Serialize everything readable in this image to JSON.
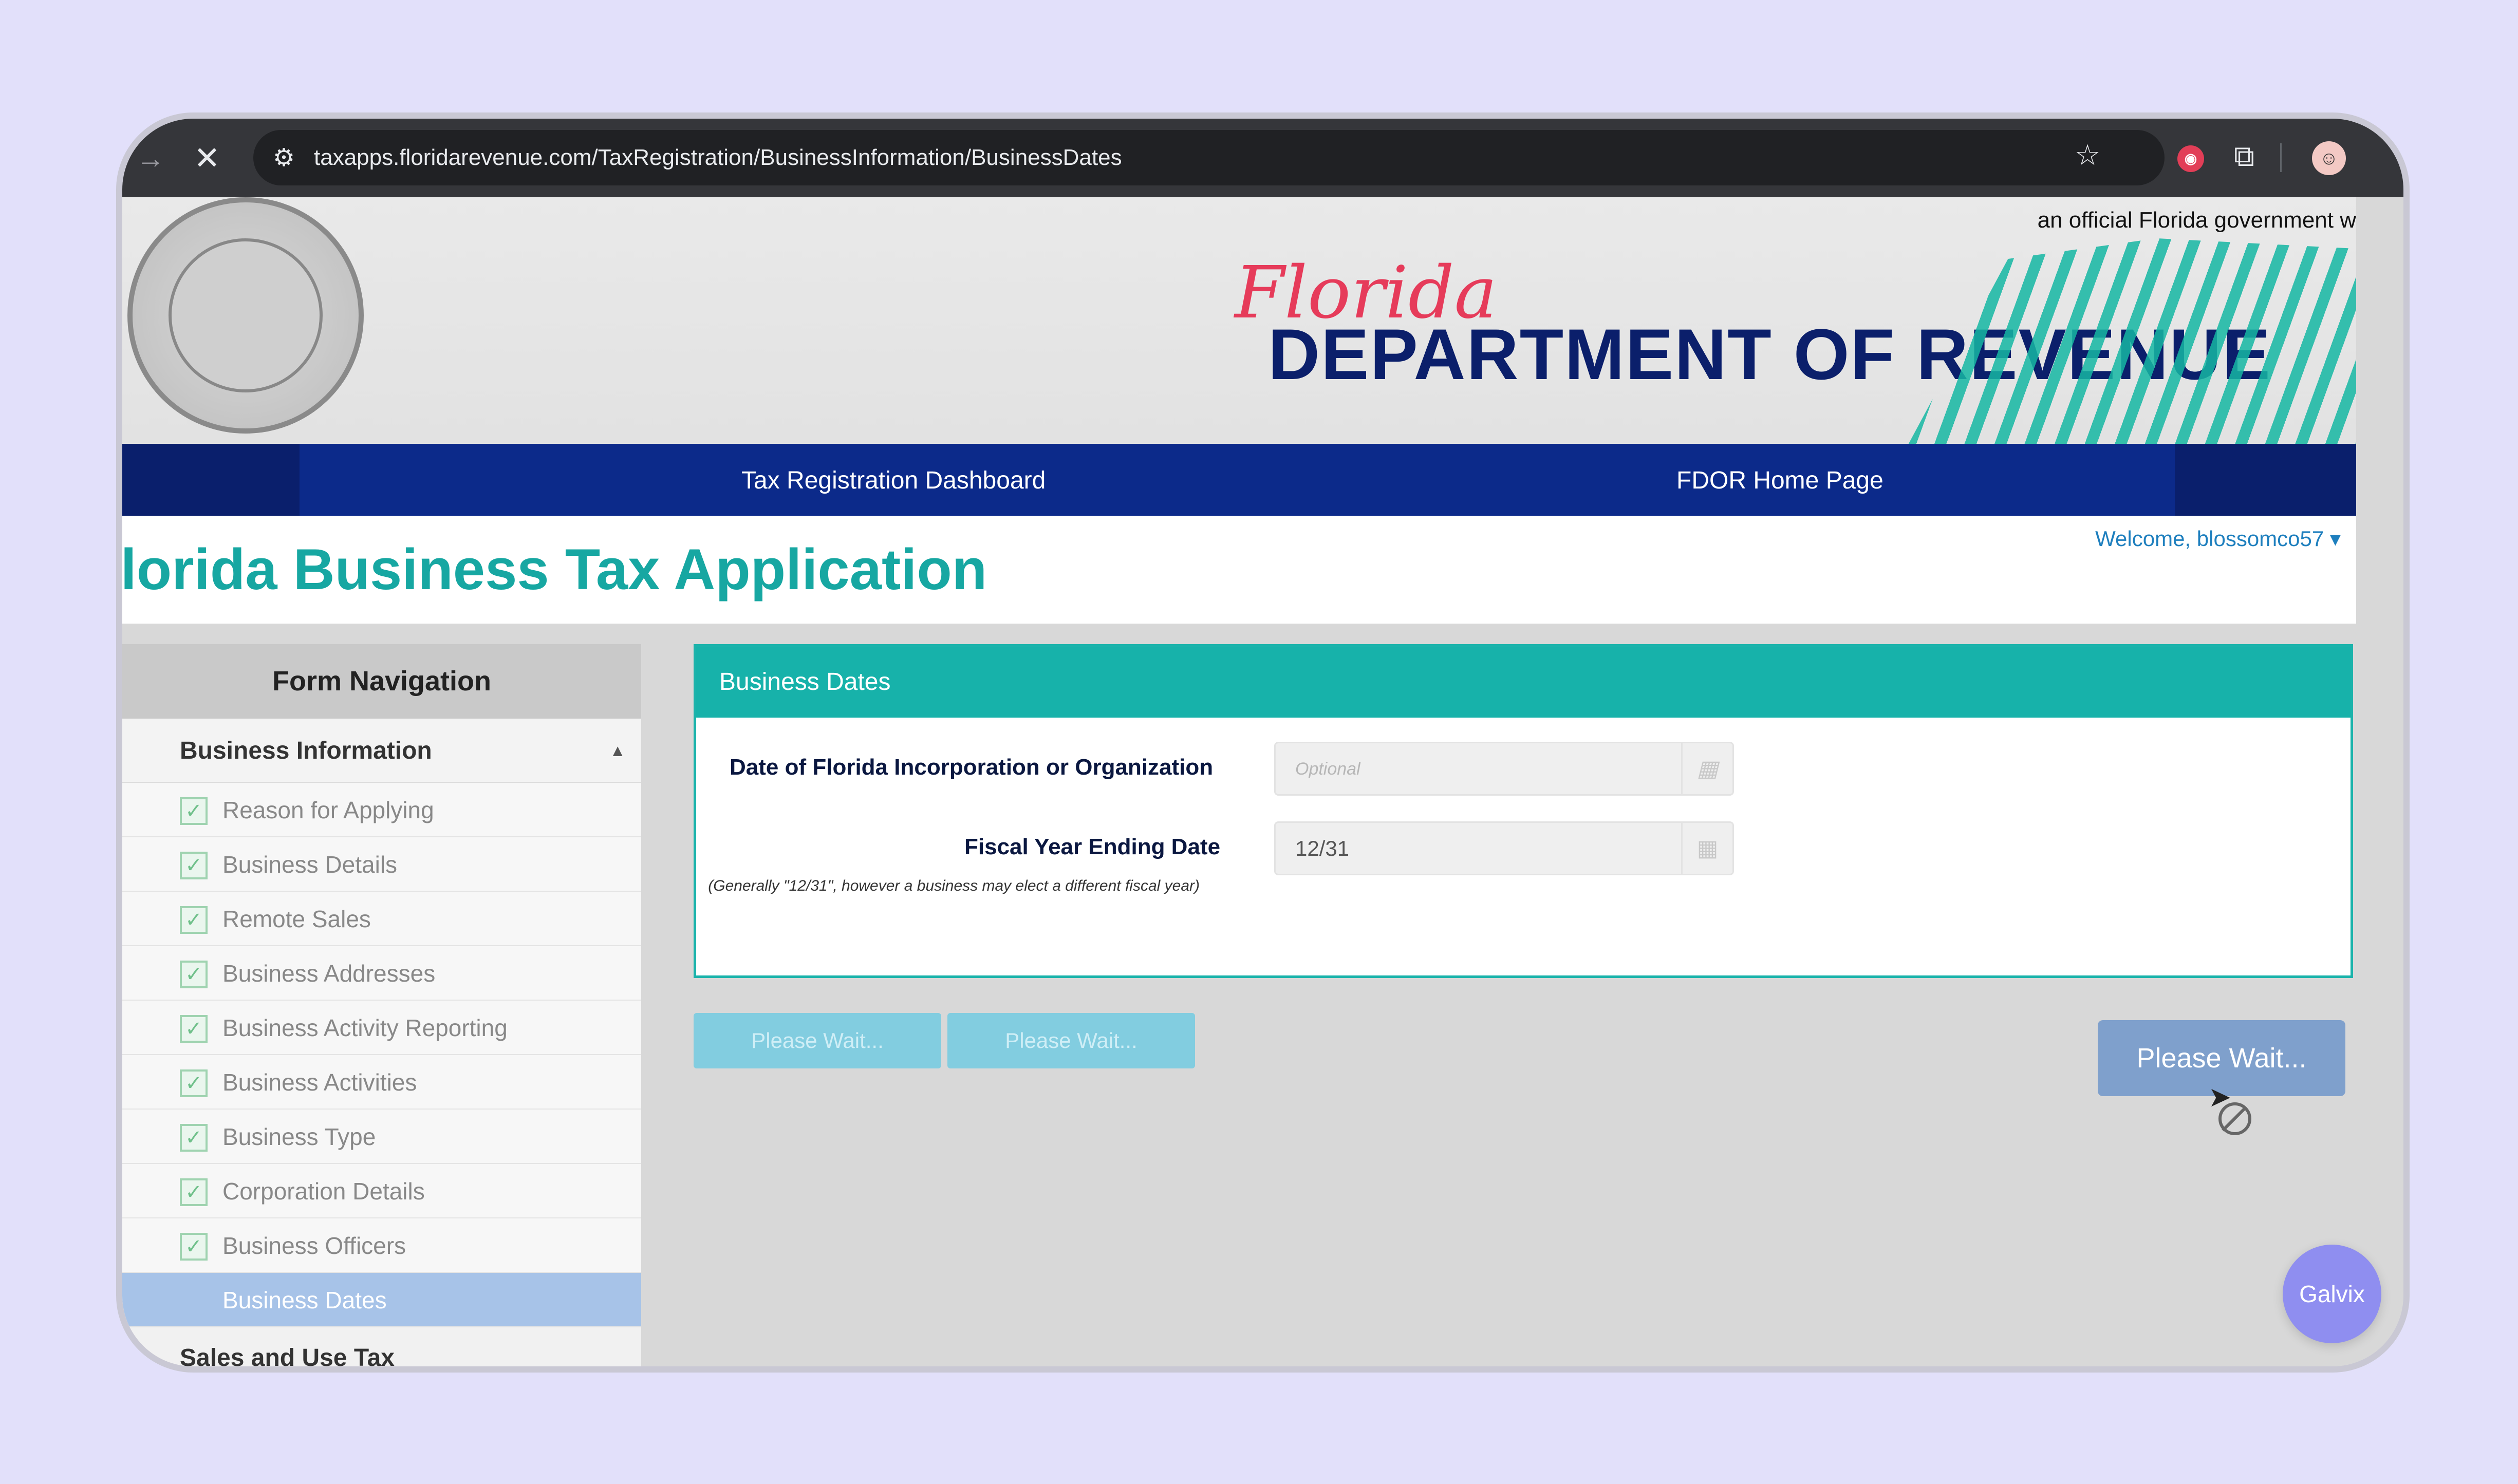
{
  "browser": {
    "url": "taxapps.floridarevenue.com/TaxRegistration/BusinessInformation/BusinessDates"
  },
  "header": {
    "official_text": "an official Florida government w",
    "script_title": "Florida",
    "dept_title": "DEPARTMENT OF REVENUE"
  },
  "nav": {
    "links": [
      "Tax Registration Dashboard",
      "FDOR Home Page"
    ]
  },
  "app": {
    "title": "'lorida Business Tax Application",
    "welcome": "Welcome, blossomco57 ▾"
  },
  "sidebar": {
    "heading": "Form Navigation",
    "section": "Business Information",
    "items": [
      {
        "label": "Reason for Applying"
      },
      {
        "label": "Business Details"
      },
      {
        "label": "Remote Sales"
      },
      {
        "label": "Business Addresses"
      },
      {
        "label": "Business Activity Reporting"
      },
      {
        "label": "Business Activities"
      },
      {
        "label": "Business Type"
      },
      {
        "label": "Corporation Details"
      },
      {
        "label": "Business Officers"
      },
      {
        "label": "Business Dates"
      }
    ],
    "next_section": "Sales and Use Tax"
  },
  "panel": {
    "heading": "Business Dates",
    "field1_label": "Date of Florida Incorporation or Organization",
    "field1_placeholder": "Optional",
    "field2_label": "Fiscal Year Ending Date",
    "field2_value": "12/31",
    "field2_note": "(Generally \"12/31\", however a business may elect a different fiscal year)"
  },
  "buttons": {
    "faded1": "Please Wait...",
    "faded2": "Please Wait...",
    "main": "Please Wait..."
  },
  "widget": {
    "label": "Galvix"
  }
}
